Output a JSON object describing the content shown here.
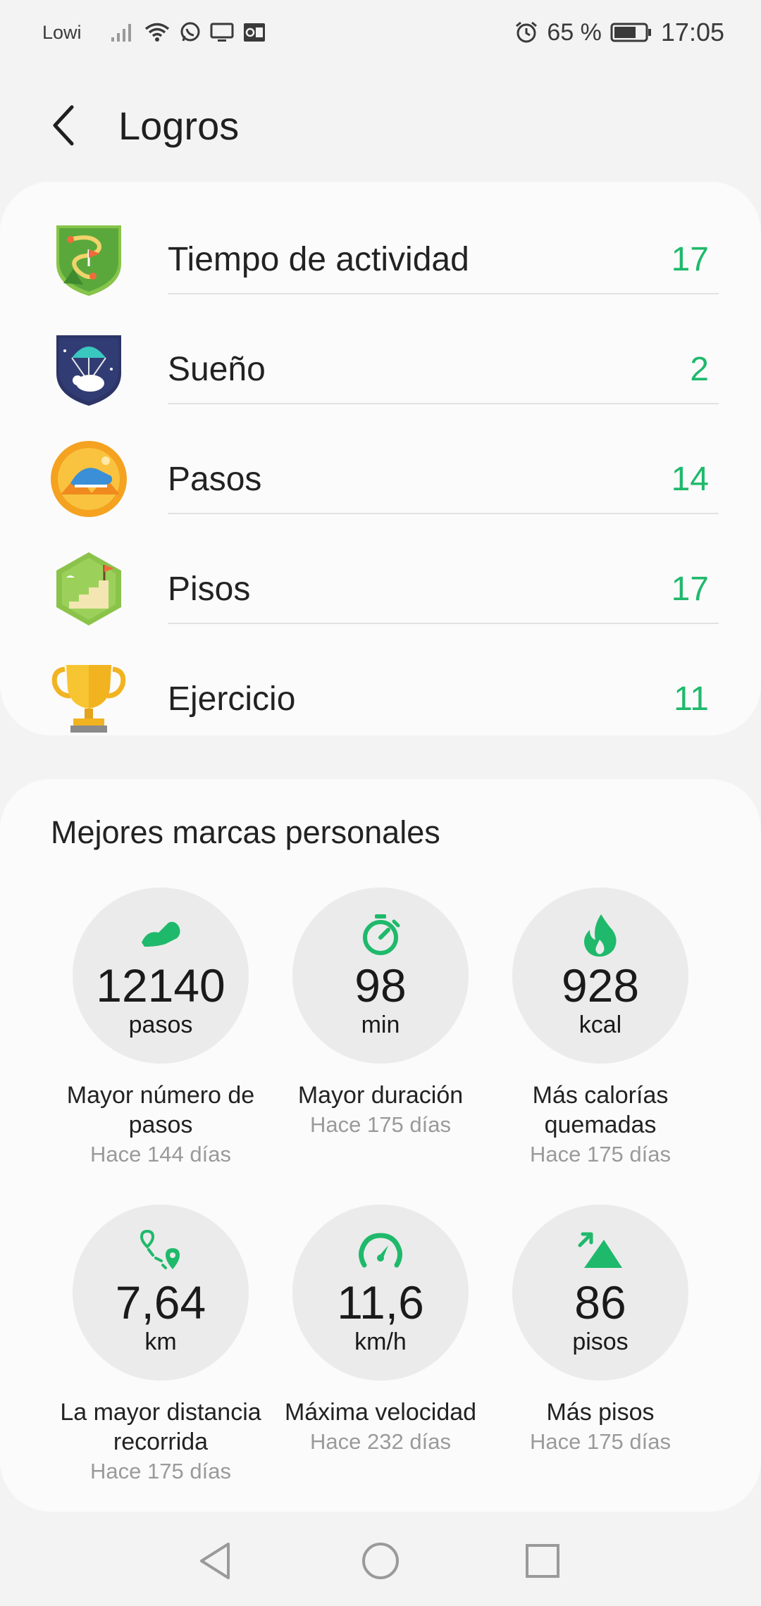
{
  "status_bar": {
    "carrier": "Lowi",
    "battery_pct": "65 %",
    "time": "17:05",
    "icons": [
      "signal-icon",
      "wifi-icon",
      "whatsapp-icon",
      "screen-icon",
      "outlook-icon",
      "alarm-icon",
      "battery-icon"
    ]
  },
  "header": {
    "title": "Logros",
    "back_icon": "back-arrow-icon"
  },
  "achievements": [
    {
      "label": "Tiempo de actividad",
      "count": "17",
      "icon": "activity-badge-icon"
    },
    {
      "label": "Sueño",
      "count": "2",
      "icon": "sleep-badge-icon"
    },
    {
      "label": "Pasos",
      "count": "14",
      "icon": "steps-badge-icon"
    },
    {
      "label": "Pisos",
      "count": "17",
      "icon": "floors-badge-icon"
    },
    {
      "label": "Ejercicio",
      "count": "11",
      "icon": "trophy-icon"
    }
  ],
  "bests": {
    "title": "Mejores marcas personales",
    "items": [
      {
        "value": "12140",
        "unit": "pasos",
        "label": "Mayor número de pasos",
        "ago": "Hace 144 días",
        "icon": "shoe-icon"
      },
      {
        "value": "98",
        "unit": "min",
        "label": "Mayor duración",
        "ago": "Hace 175 días",
        "icon": "stopwatch-icon"
      },
      {
        "value": "928",
        "unit": "kcal",
        "label": "Más calorías quemadas",
        "ago": "Hace 175 días",
        "icon": "flame-icon"
      },
      {
        "value": "7,64",
        "unit": "km",
        "label": "La mayor distancia recorrida",
        "ago": "Hace 175 días",
        "icon": "route-icon"
      },
      {
        "value": "11,6",
        "unit": "km/h",
        "label": "Máxima velocidad",
        "ago": "Hace 232 días",
        "icon": "speedometer-icon"
      },
      {
        "value": "86",
        "unit": "pisos",
        "label": "Más pisos",
        "ago": "Hace 175 días",
        "icon": "mountain-icon"
      }
    ]
  },
  "nav_bar": [
    "back-triangle-icon",
    "home-circle-icon",
    "recents-square-icon"
  ],
  "colors": {
    "accent": "#1fb96b",
    "background": "#f3f3f3",
    "card": "#fbfbfb"
  }
}
